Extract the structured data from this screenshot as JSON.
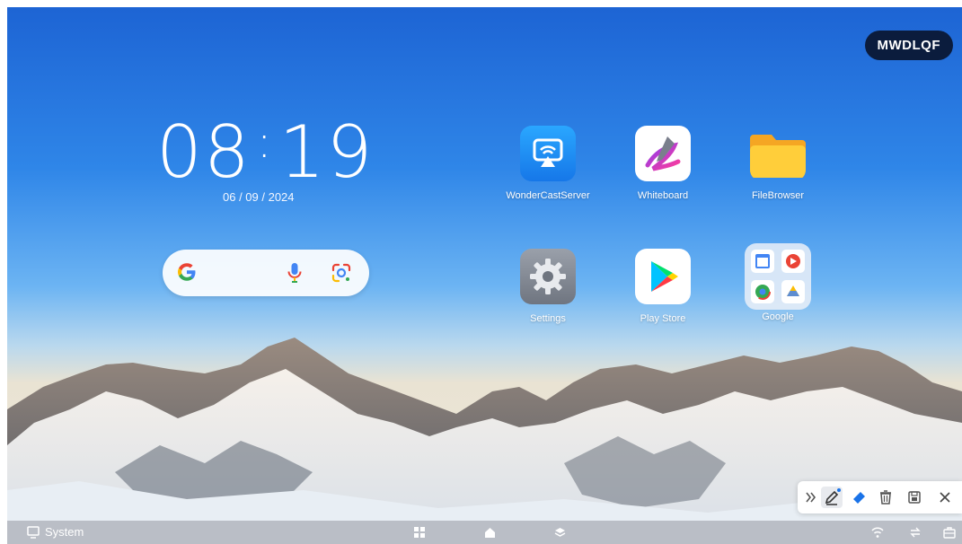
{
  "badge": {
    "text": "MWDLQF"
  },
  "clock": {
    "hours": "08",
    "separator": ":",
    "minutes": "19",
    "date": "06 / 09 / 2024"
  },
  "apps": [
    {
      "label": "WonderCastServer",
      "icon": "cast-icon"
    },
    {
      "label": "Whiteboard",
      "icon": "pen-icon"
    },
    {
      "label": "FileBrowser",
      "icon": "folder-icon"
    },
    {
      "label": "Settings",
      "icon": "gear-icon"
    },
    {
      "label": "Play Store",
      "icon": "play-store-icon"
    },
    {
      "label": "Google",
      "icon": "google-folder-icon"
    }
  ],
  "taskbar": {
    "system_label": "System"
  },
  "colors": {
    "accent_blue": "#1a73e8",
    "google_red": "#ea4335",
    "google_yellow": "#fbbc04",
    "google_green": "#34a853"
  }
}
